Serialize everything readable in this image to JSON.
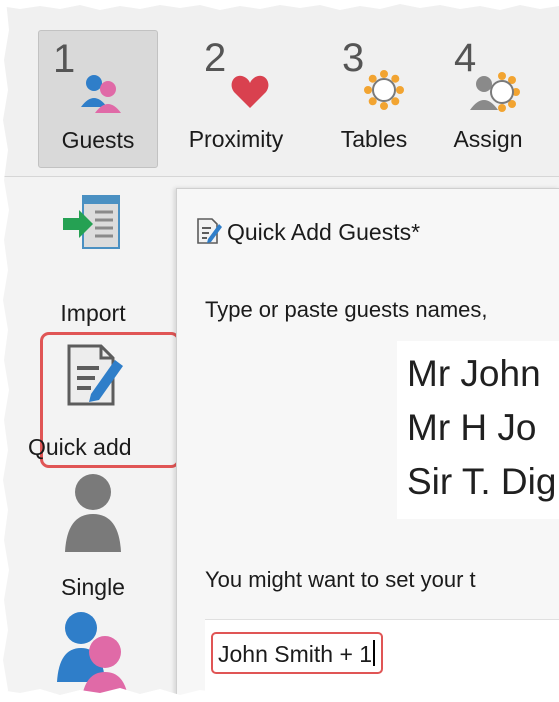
{
  "toolbar": {
    "items": [
      {
        "number": "1",
        "label": "Guests",
        "icon": "guests-icon",
        "active": true
      },
      {
        "number": "2",
        "label": "Proximity",
        "icon": "heart-icon",
        "active": false
      },
      {
        "number": "3",
        "label": "Tables",
        "icon": "table-gear-icon",
        "active": false
      },
      {
        "number": "4",
        "label": "Assign",
        "icon": "assign-gear-icon",
        "active": false
      }
    ]
  },
  "sidebar": {
    "items": [
      {
        "label": "Import",
        "icon": "import-icon"
      },
      {
        "label": "Quick add",
        "icon": "quick-add-icon",
        "highlighted": true
      },
      {
        "label": "Single",
        "icon": "single-person-icon"
      },
      {
        "label": "",
        "icon": "couple-icon"
      }
    ]
  },
  "dialog": {
    "title": "Quick Add Guests*",
    "instructions": "Type or paste guests names,",
    "example_lines": [
      "Mr John",
      "Mr H Jo",
      "Sir T. Dig"
    ],
    "hint": "You might want to set your t",
    "entry_value": "John Smith + 1"
  },
  "colors": {
    "highlight": "#e05555",
    "heart": "#d9414f",
    "person_blue": "#2f7ec9",
    "person_pink": "#e06aa7",
    "gear_orange": "#f2a431",
    "import_green": "#25a153"
  }
}
